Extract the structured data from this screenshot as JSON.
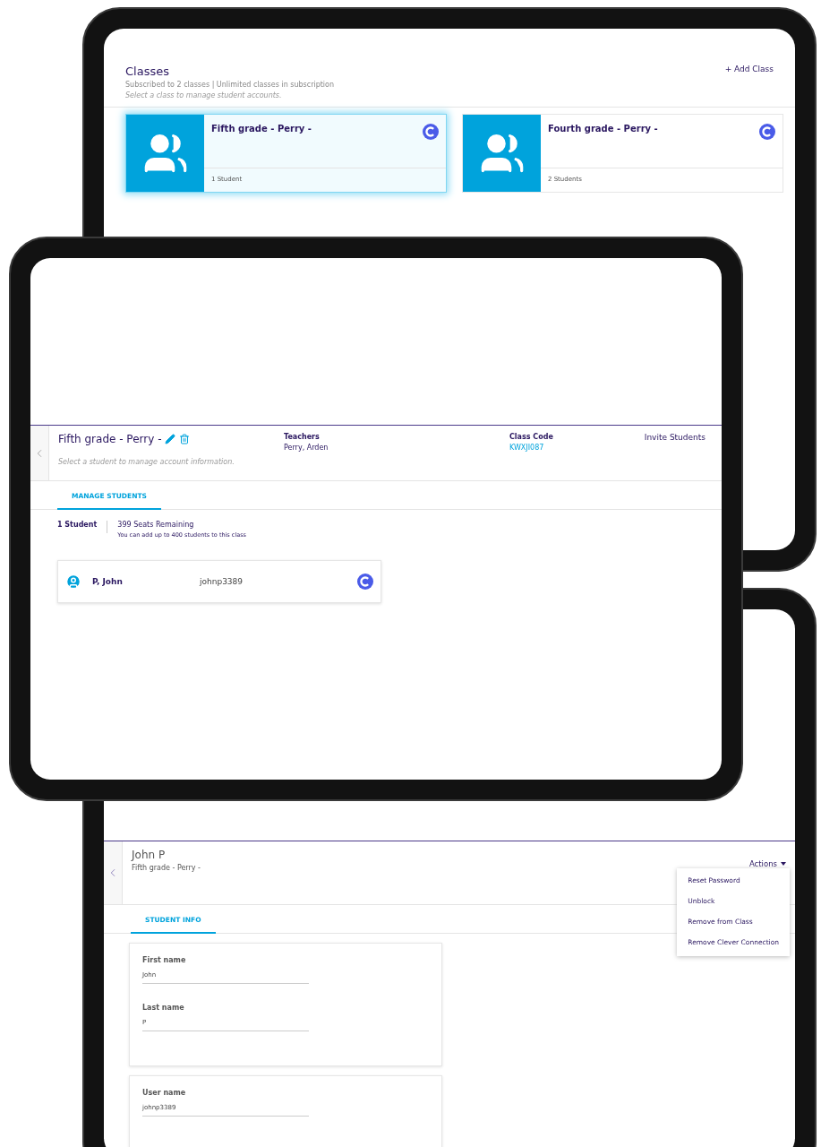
{
  "classes_screen": {
    "title": "Classes",
    "subtitle": "Subscribed to 2 classes | Unlimited classes in subscription",
    "hint": "Select a class to manage student accounts.",
    "add_button": "+ Add Class",
    "classes": [
      {
        "name": "Fifth grade - Perry -",
        "students": "1 Student",
        "selected": true
      },
      {
        "name": "Fourth grade - Perry -",
        "students": "2 Students",
        "selected": false
      }
    ]
  },
  "class_screen": {
    "title": "Fifth grade - Perry -",
    "hint": "Select a student to manage account information.",
    "teachers_label": "Teachers",
    "teachers": "Perry, Arden",
    "code_label": "Class Code",
    "code": "KWXJI087",
    "invite_button": "Invite Students",
    "tabs": [
      {
        "label": "MANAGE STUDENTS",
        "selected": true
      }
    ],
    "student_count": "1 Student",
    "seats": "399 Seats Remaining",
    "seats_note": "You can add up to 400 students to this class",
    "students": [
      {
        "name": "P, John",
        "username": "johnp3389"
      }
    ]
  },
  "student_screen": {
    "name": "John P",
    "class": "Fifth grade - Perry -",
    "actions_button": "Actions",
    "actions_menu": [
      "Reset Password",
      "Unblock",
      "Remove from Class",
      "Remove Clever Connection"
    ],
    "tabs": [
      {
        "label": "STUDENT INFO",
        "selected": true
      }
    ],
    "cards": [
      {
        "fields": [
          {
            "label": "First name",
            "value": "John"
          },
          {
            "label": "Last name",
            "value": "P"
          }
        ]
      },
      {
        "fields": [
          {
            "label": "User name",
            "value": "johnp3389"
          }
        ]
      }
    ]
  }
}
